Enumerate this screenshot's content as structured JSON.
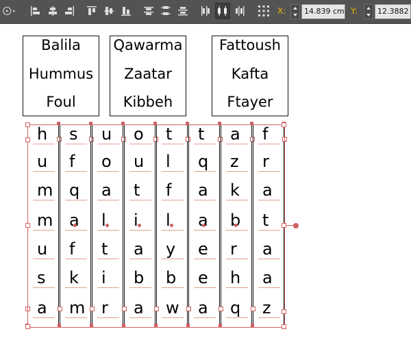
{
  "toolbar": {
    "x_label": "X:",
    "x_value": "14.839 cm",
    "y_label": "Y:",
    "y_value": "12.3882 c",
    "icons": [
      "reference-point-icon",
      "align-left-edges-icon",
      "align-horizontal-centers-icon",
      "align-right-edges-icon",
      "align-top-edges-icon",
      "align-vertical-centers-icon",
      "align-bottom-edges-icon",
      "distribute-top-edges-icon",
      "distribute-vertical-centers-icon",
      "distribute-bottom-edges-icon",
      "distribute-left-edges-icon",
      "distribute-horizontal-centers-icon",
      "distribute-right-edges-icon",
      "reference-point-grid-icon"
    ]
  },
  "word_boxes": [
    {
      "words": [
        "Balila",
        "Hummus",
        "Foul"
      ]
    },
    {
      "words": [
        "Qawarma",
        "Zaatar",
        "Kibbeh"
      ]
    },
    {
      "words": [
        "Fattoush",
        "Kafta",
        "Ftayer"
      ]
    }
  ],
  "grid": {
    "columns": [
      [
        "h",
        "u",
        "m",
        "m",
        "u",
        "s",
        "a"
      ],
      [
        "s",
        "f",
        "q",
        "a",
        "f",
        "k",
        "m"
      ],
      [
        "u",
        "o",
        "a",
        "l",
        "t",
        "i",
        "r"
      ],
      [
        "o",
        "u",
        "t",
        "i",
        "a",
        "b",
        "a"
      ],
      [
        "t",
        "l",
        "f",
        "l",
        "y",
        "b",
        "w"
      ],
      [
        "t",
        "q",
        "a",
        "a",
        "e",
        "e",
        "a"
      ],
      [
        "a",
        "z",
        "k",
        "b",
        "r",
        "h",
        "q"
      ],
      [
        "f",
        "r",
        "a",
        "t",
        "a",
        "a",
        "z"
      ]
    ]
  },
  "colors": {
    "toolbar_bg": "#535353",
    "selection": "#d06060",
    "coord_label": "#f0b400"
  }
}
